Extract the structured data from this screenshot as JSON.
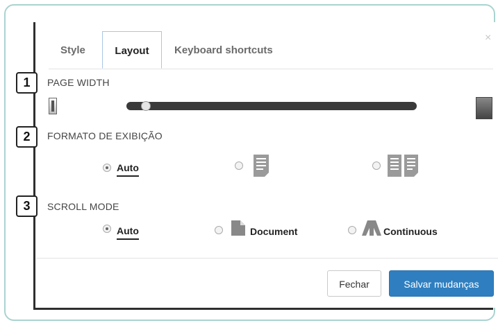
{
  "tabs": [
    {
      "label": "Style"
    },
    {
      "label": "Layout"
    },
    {
      "label": "Keyboard shortcuts"
    }
  ],
  "close_glyph": "×",
  "sections": {
    "page_width": {
      "badge": "1",
      "label": "PAGE WIDTH",
      "slider_value_fraction": 0.05
    },
    "display_format": {
      "badge": "2",
      "label": "FORMATO DE EXIBIÇÃO",
      "options": [
        {
          "label": "Auto",
          "selected": true
        },
        {
          "icon": "single-page-icon",
          "selected": false
        },
        {
          "icon": "two-page-icon",
          "selected": false
        }
      ]
    },
    "scroll_mode": {
      "badge": "3",
      "label": "SCROLL MODE",
      "options": [
        {
          "label": "Auto",
          "selected": true
        },
        {
          "label": "Document",
          "icon": "document-icon",
          "selected": false
        },
        {
          "label": "Continuous",
          "icon": "continuous-icon",
          "selected": false
        }
      ]
    }
  },
  "footer": {
    "close_label": "Fechar",
    "save_label": "Salvar mudanças"
  },
  "colors": {
    "primary": "#2f7fc0",
    "frame_border": "#a9d3cf",
    "tab_active_border": "#a7c6e6"
  }
}
